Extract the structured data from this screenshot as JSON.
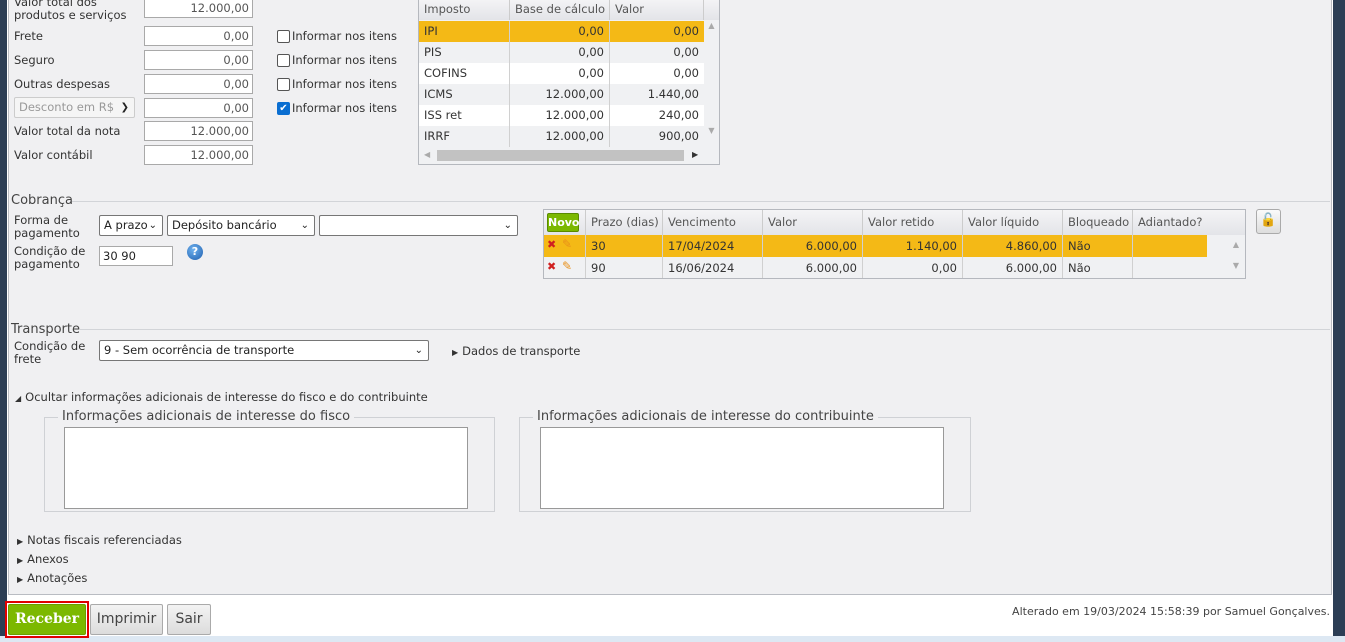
{
  "totals": {
    "rows": [
      {
        "label": "Valor total dos produtos e serviços",
        "value": "12.000,00"
      },
      {
        "label": "Frete",
        "value": "0,00",
        "check": "Informar nos itens",
        "checked": false
      },
      {
        "label": "Seguro",
        "value": "0,00",
        "check": "Informar nos itens",
        "checked": false
      },
      {
        "label": "Outras despesas",
        "value": "0,00",
        "check": "Informar nos itens",
        "checked": false
      },
      {
        "label": "Desconto em R$",
        "value": "0,00",
        "check": "Informar nos itens",
        "checked": true
      },
      {
        "label": "Valor total da nota",
        "value": "12.000,00"
      },
      {
        "label": "Valor contábil",
        "value": "12.000,00"
      }
    ]
  },
  "taxes": {
    "headers": [
      "Imposto",
      "Base de cálculo",
      "Valor"
    ],
    "rows": [
      [
        "IPI",
        "0,00",
        "0,00"
      ],
      [
        "PIS",
        "0,00",
        "0,00"
      ],
      [
        "COFINS",
        "0,00",
        "0,00"
      ],
      [
        "ICMS",
        "12.000,00",
        "1.440,00"
      ],
      [
        "ISS ret",
        "12.000,00",
        "240,00"
      ],
      [
        "IRRF",
        "12.000,00",
        "900,00"
      ]
    ]
  },
  "cobranca": {
    "legend": "Cobrança",
    "forma_label": "Forma de pagamento",
    "forma_value": "A prazo",
    "meio_value": "Depósito bancário",
    "conta_value": "",
    "condicao_label": "Condição de pagamento",
    "condicao_value": "30 90",
    "novo_label": "Novo",
    "headers": [
      "Prazo (dias)",
      "Vencimento",
      "Valor",
      "Valor retido",
      "Valor líquido",
      "Bloqueado",
      "Adiantado?"
    ],
    "rows": [
      [
        "30",
        "17/04/2024",
        "6.000,00",
        "1.140,00",
        "4.860,00",
        "Não",
        ""
      ],
      [
        "90",
        "16/06/2024",
        "6.000,00",
        "0,00",
        "6.000,00",
        "Não",
        ""
      ]
    ]
  },
  "transporte": {
    "legend": "Transporte",
    "frete_label": "Condição de frete",
    "frete_value": "9 - Sem ocorrência de transporte",
    "dados_link": "Dados de transporte"
  },
  "info": {
    "toggle": "Ocultar informações adicionais de interesse do fisco e do contribuinte",
    "fisco_legend": "Informações adicionais de interesse do fisco",
    "contrib_legend": "Informações adicionais de interesse do contribuinte",
    "fisco_value": "",
    "contrib_value": ""
  },
  "sections": [
    "Notas fiscais referenciadas",
    "Anexos",
    "Anotações"
  ],
  "footer": {
    "receber": "Receber",
    "imprimir": "Imprimir",
    "sair": "Sair",
    "altered": "Alterado em 19/03/2024 15:58:39 por Samuel Gonçalves."
  },
  "colors": {
    "accent": "#f4b916",
    "green": "#7cb800",
    "sidebar": "#2c3e55"
  }
}
